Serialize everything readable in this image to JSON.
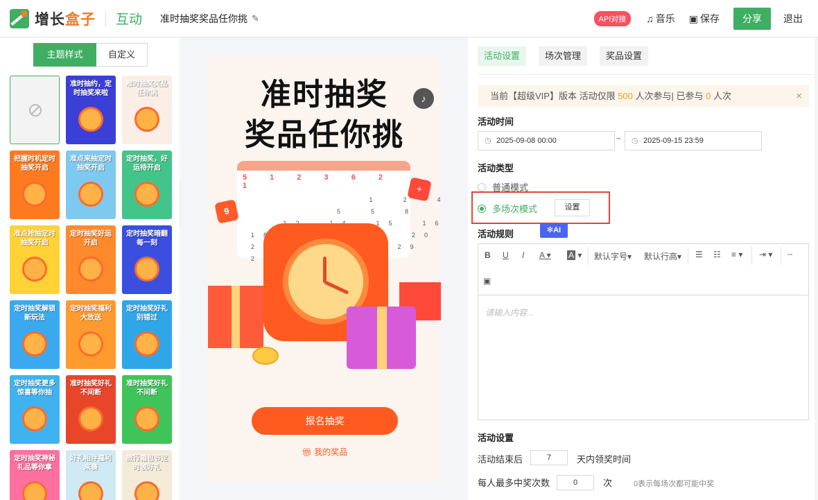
{
  "header": {
    "logo_text_main": "增长",
    "logo_text_accent": "盒子",
    "module": "互动",
    "activity_name": "准时抽奖奖品任你挑",
    "api_badge": "API对接",
    "music": "音乐",
    "save": "保存",
    "share": "分享",
    "exit": "退出"
  },
  "left_panel": {
    "tab_theme": "主题样式",
    "tab_custom": "自定义",
    "collapse_arrow": "‹",
    "templates": [
      {
        "title": "",
        "bg": "#f3f3f3"
      },
      {
        "title": "准时抽约，定时抽奖来啦",
        "bg": "#3a3fd8"
      },
      {
        "title": "准时抽奖奖品任你挑",
        "bg": "#fbeee6"
      },
      {
        "title": "把握时机定时抽奖开启",
        "bg": "#ff7a1f"
      },
      {
        "title": "准点来抽定时抽奖开启",
        "bg": "#7ec9ef"
      },
      {
        "title": "定时抽奖，好运待开启",
        "bg": "#43c48a"
      },
      {
        "title": "准点抢抽定时抽奖开启",
        "bg": "#ffd236"
      },
      {
        "title": "定时抽奖好运开启",
        "bg": "#ff8a2e"
      },
      {
        "title": "定时抽奖暗翻每一刻",
        "bg": "#3a4fe0"
      },
      {
        "title": "定时抽奖解锁新玩法",
        "bg": "#3aa9ef"
      },
      {
        "title": "定时抽奖福利大放送",
        "bg": "#ff9a2e"
      },
      {
        "title": "定时抽奖好礼别错过",
        "bg": "#2fa6e8"
      },
      {
        "title": "定时抽奖更多惊喜等你抽",
        "bg": "#3fb3f0"
      },
      {
        "title": "准时抽奖好礼不间断",
        "bg": "#e8462a"
      },
      {
        "title": "准时抽奖好礼不间断",
        "bg": "#3fc45a"
      },
      {
        "title": "定时抽奖神秘礼品等你拿",
        "bg": "#ff6fa0"
      },
      {
        "title": "好礼相伴福利来袭",
        "bg": "#cfe9f5"
      },
      {
        "title": "旅行箱包节定时领好礼",
        "bg": "#f4ead8"
      }
    ]
  },
  "preview": {
    "title_line1": "准时抽奖",
    "title_line2": "奖品任你挑",
    "cal_header": "5 1 2 3 6 2 1",
    "cal_rows": "           1  2  4\n        5  5  8\n   12  14  15  16\n18  16    19  20  23\n25  26       29\n29  30",
    "badge_nine": "9",
    "badge_plus": "+",
    "signup": "报名抽奖",
    "my_prize": "我的奖品"
  },
  "right_panel": {
    "tabs": [
      "活动设置",
      "场次管理",
      "奖品设置"
    ],
    "notice_prefix": "当前【超级VIP】版本 活动仅限",
    "notice_limit": "500",
    "notice_mid": "人次参与| 已参与",
    "notice_count": "0",
    "notice_suffix": "人次",
    "time_label": "活动时间",
    "start_time": "2025-09-08 00:00",
    "end_time": "2025-09-15 23:59",
    "type_label": "活动类型",
    "mode_normal": "普通模式",
    "mode_multi": "多场次模式",
    "setting_btn": "设置",
    "rules_label": "活动规则",
    "ai_label": "✻AI",
    "toolbar": {
      "bold": "B",
      "underline": "U",
      "italic": "I",
      "font_color": "A",
      "bg_color": "A",
      "font_size": "默认字号",
      "line_height": "默认行高",
      "image": "▣"
    },
    "editor_placeholder": "请输入内容...",
    "settings_label": "活动设置",
    "end_after_prefix": "活动结束后",
    "end_after_value": "7",
    "end_after_suffix": "天内领奖时间",
    "max_win_prefix": "每人最多中奖次数",
    "max_win_value": "0",
    "max_win_suffix": "次",
    "max_win_hint": "0表示每场次都可能中奖"
  },
  "colors": {
    "brand_green": "#3fae62",
    "accent_orange": "#ff5a1f",
    "highlight_red": "#e1453c",
    "ai_blue": "#4a66f0"
  }
}
